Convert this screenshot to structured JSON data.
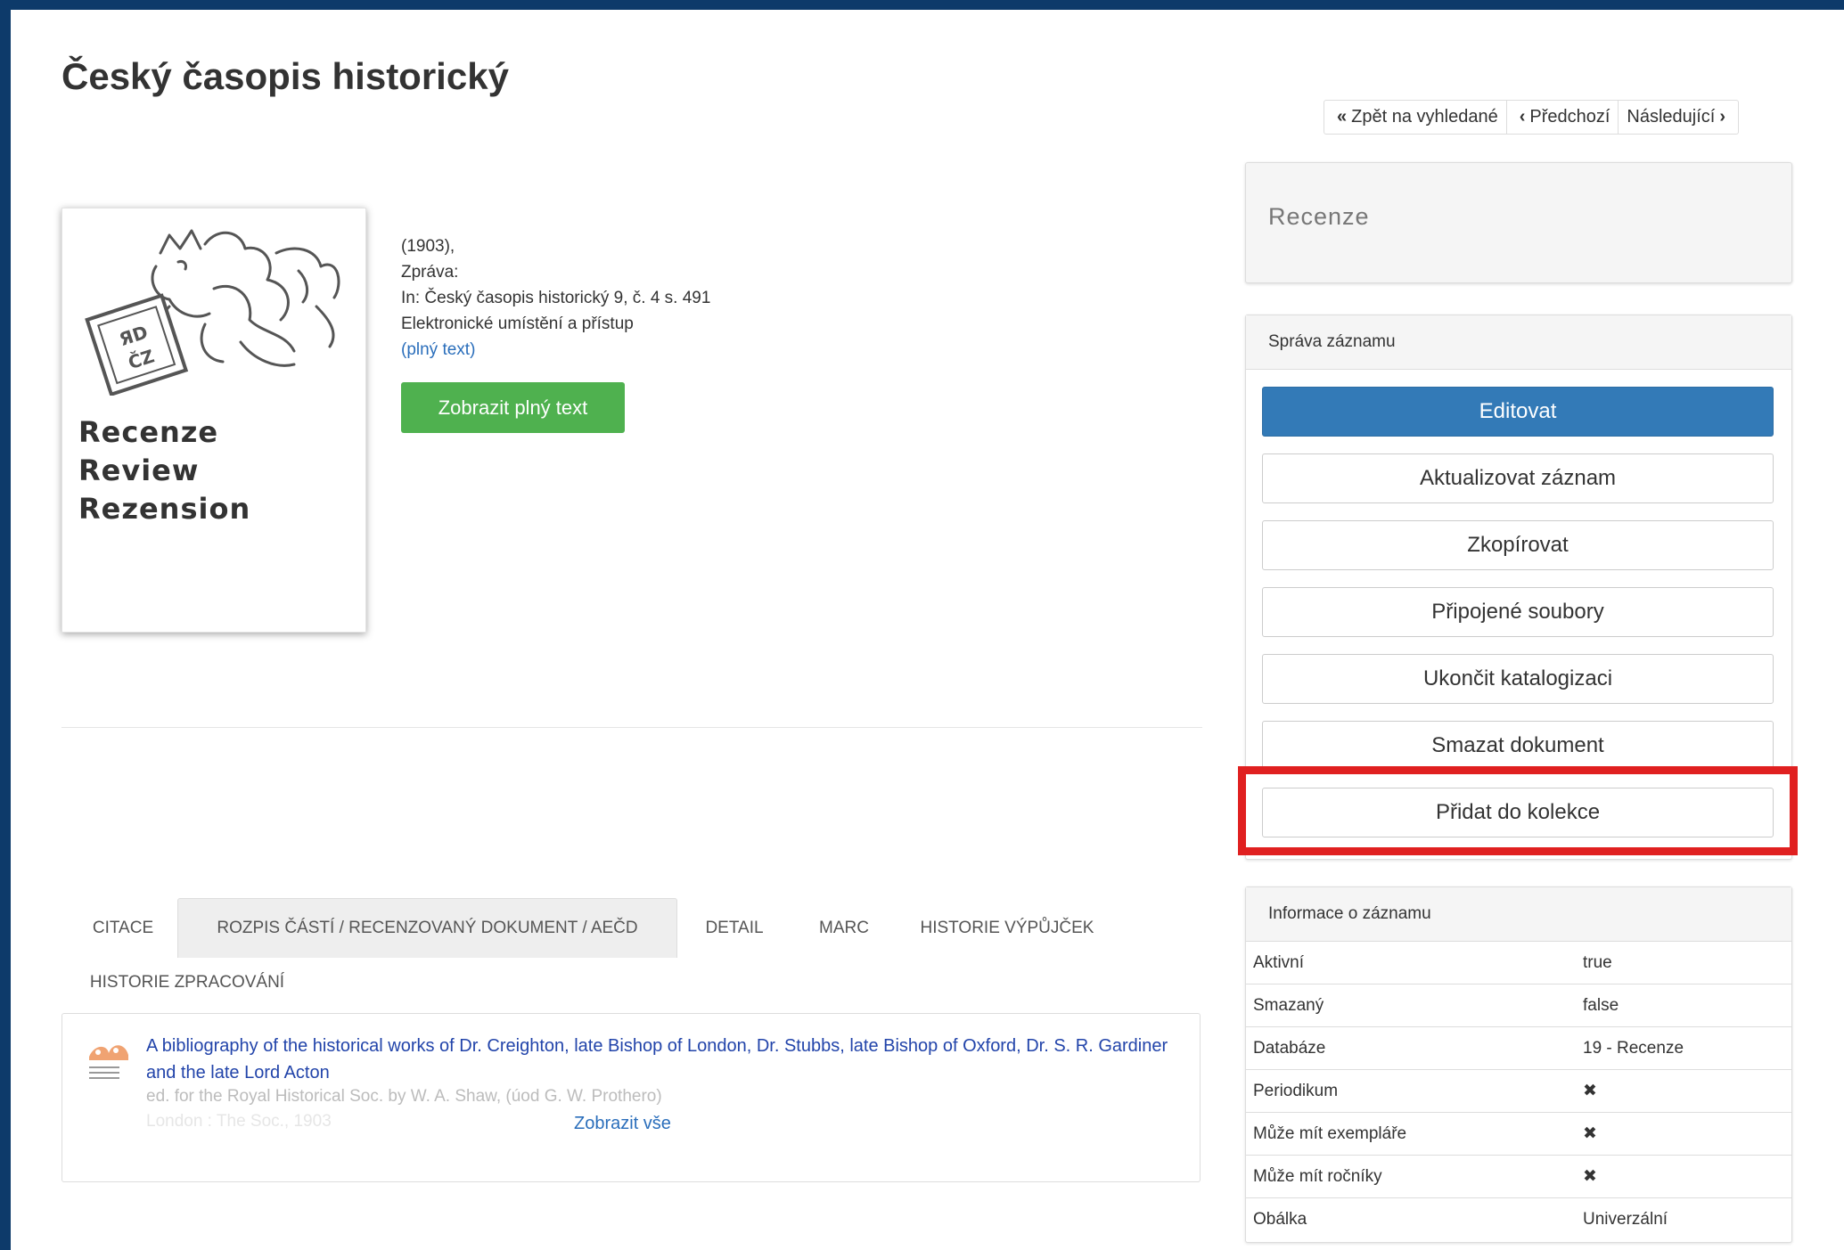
{
  "header": {
    "title": "Český časopis historický"
  },
  "pager": {
    "back": "Zpět na vyhledané",
    "prev": "Předchozí",
    "next": "Následující"
  },
  "cover": {
    "lines": [
      "Recenze",
      "Review",
      "Rezension"
    ]
  },
  "record": {
    "year": "(1903),",
    "type_label": "Zpráva:",
    "in_line": "In: Český časopis historický 9, č. 4 s. 491",
    "access_label": "Elektronické umístění a přístup",
    "fulltext_link": "(plný text)",
    "fulltext_button": "Zobrazit plný text"
  },
  "tabs": [
    {
      "label": "CITACE",
      "active": false
    },
    {
      "label": "ROZPIS ČÁSTÍ / RECENZOVANÝ DOKUMENT / AEČD",
      "active": true
    },
    {
      "label": "DETAIL",
      "active": false
    },
    {
      "label": "MARC",
      "active": false
    },
    {
      "label": "HISTORIE VÝPŮJČEK",
      "active": false
    },
    {
      "label": "HISTORIE ZPRACOVÁNÍ",
      "active": false
    }
  ],
  "parts": {
    "title": "A bibliography of the historical works of Dr. Creighton, late Bishop of London, Dr. Stubbs, late Bishop of Oxford, Dr. S. R. Gardiner and the late Lord Acton",
    "subtitle": "ed. for the Royal Historical Soc. by W. A. Shaw, (úod G. W. Prothero)",
    "imprint": "London : The Soc., 1903",
    "show_all": "Zobrazit vše"
  },
  "sidebar": {
    "record_type": "Recenze",
    "management": {
      "title": "Správa záznamu",
      "buttons": [
        "Editovat",
        "Aktualizovat záznam",
        "Zkopírovat",
        "Připojené soubory",
        "Ukončit katalogizaci",
        "Smazat dokument",
        "Přidat do kolekce"
      ]
    },
    "info": {
      "title": "Informace o záznamu",
      "rows": [
        {
          "label": "Aktivní",
          "value": "true"
        },
        {
          "label": "Smazaný",
          "value": "false"
        },
        {
          "label": "Databáze",
          "value": "19 - Recenze"
        },
        {
          "label": "Periodikum",
          "value": "✖"
        },
        {
          "label": "Může mít exempláře",
          "value": "✖"
        },
        {
          "label": "Může mít ročníky",
          "value": "✖"
        },
        {
          "label": "Obálka",
          "value": "Univerzální"
        }
      ]
    }
  },
  "colors": {
    "frame": "#0d3a6a",
    "primary": "#337ab7",
    "success": "#4fb14f",
    "highlight": "#e02020",
    "link": "#2a6ebb"
  }
}
